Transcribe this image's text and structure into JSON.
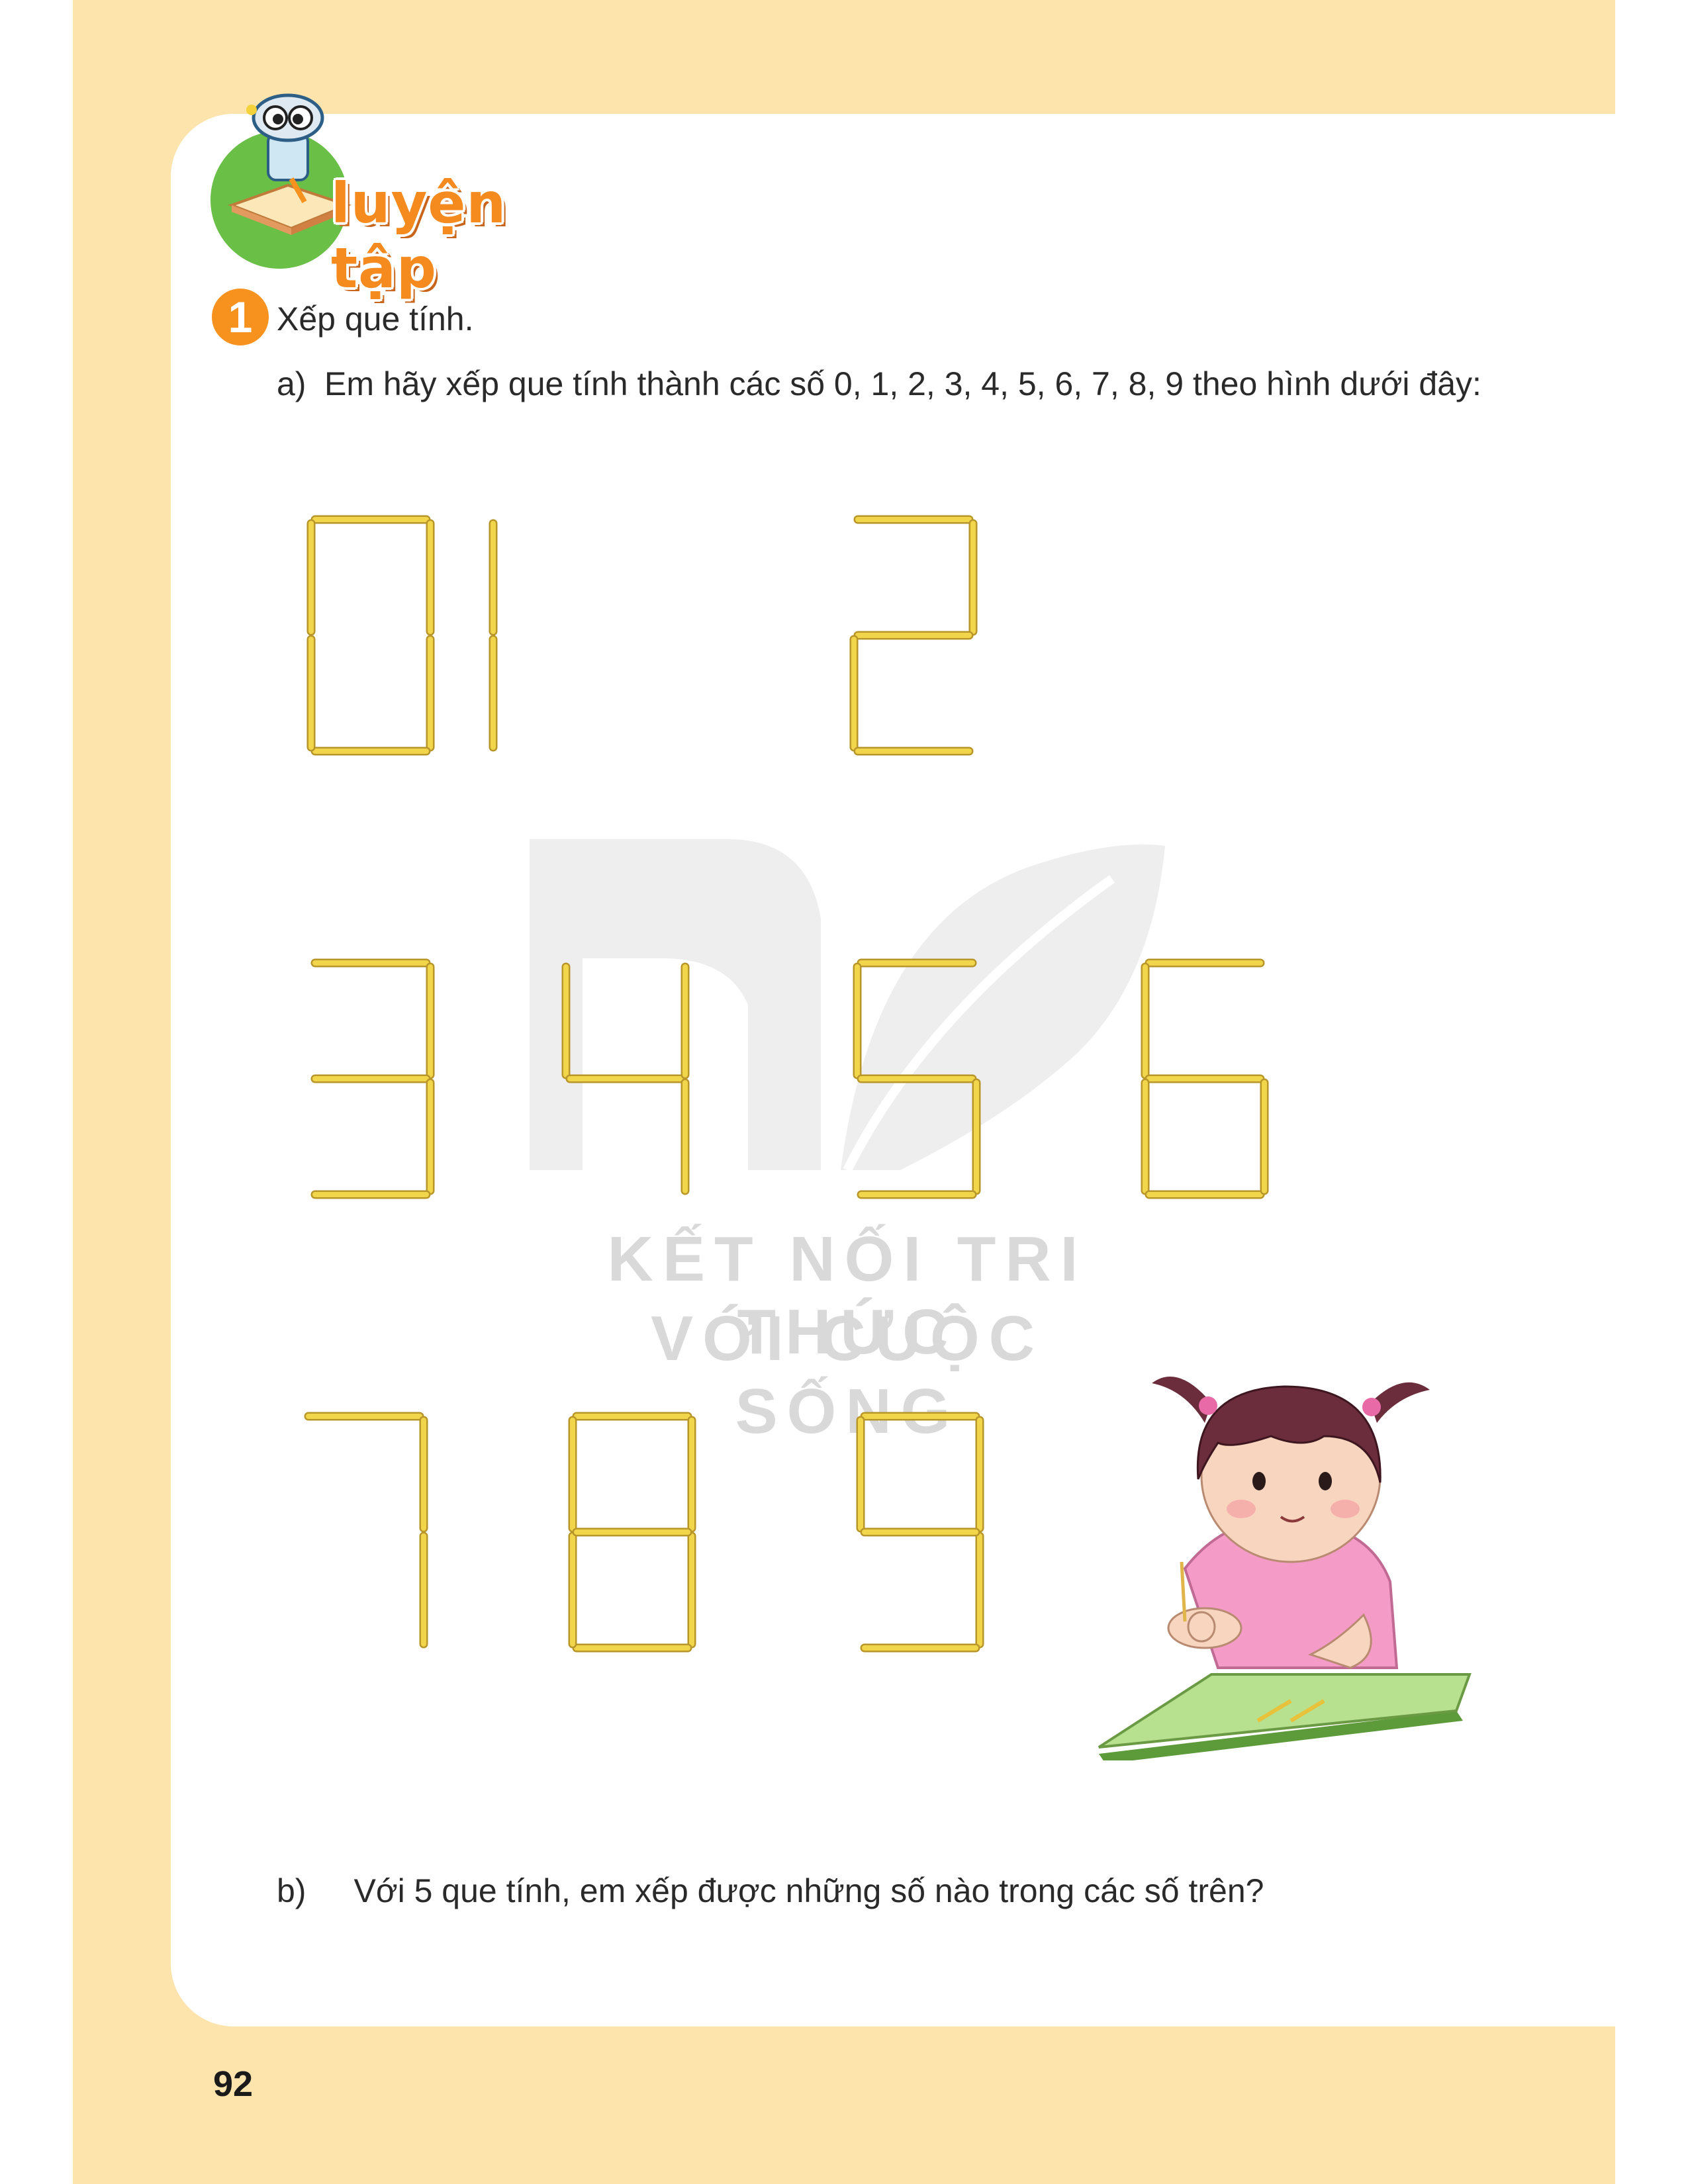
{
  "heading": {
    "title": "luyện tập",
    "icon": "robot-reading-icon"
  },
  "task1": {
    "number": "1",
    "title": "Xếp que tính.",
    "part_a": {
      "letter": "a)",
      "text": "Em hãy xếp que tính thành các số 0, 1, 2, 3, 4, 5, 6, 7, 8, 9 theo hình dưới đây:"
    },
    "digits": [
      "0",
      "1",
      "2",
      "3",
      "4",
      "5",
      "6",
      "7",
      "8",
      "9"
    ],
    "part_b": {
      "letter": "b)",
      "text": "Với 5 que tính, em xếp được những số nào trong các số trên?"
    }
  },
  "watermark": {
    "line1": "KẾT NỐI TRI THỨC",
    "line2": "VỚI CUỘC SỐNG"
  },
  "page_number": "92",
  "colors": {
    "frame": "#fde3ac",
    "stick": "#f1d64b",
    "accent_orange": "#f7921e",
    "heading_green": "#6abf47"
  },
  "illustration": "girl-arranging-sticks"
}
